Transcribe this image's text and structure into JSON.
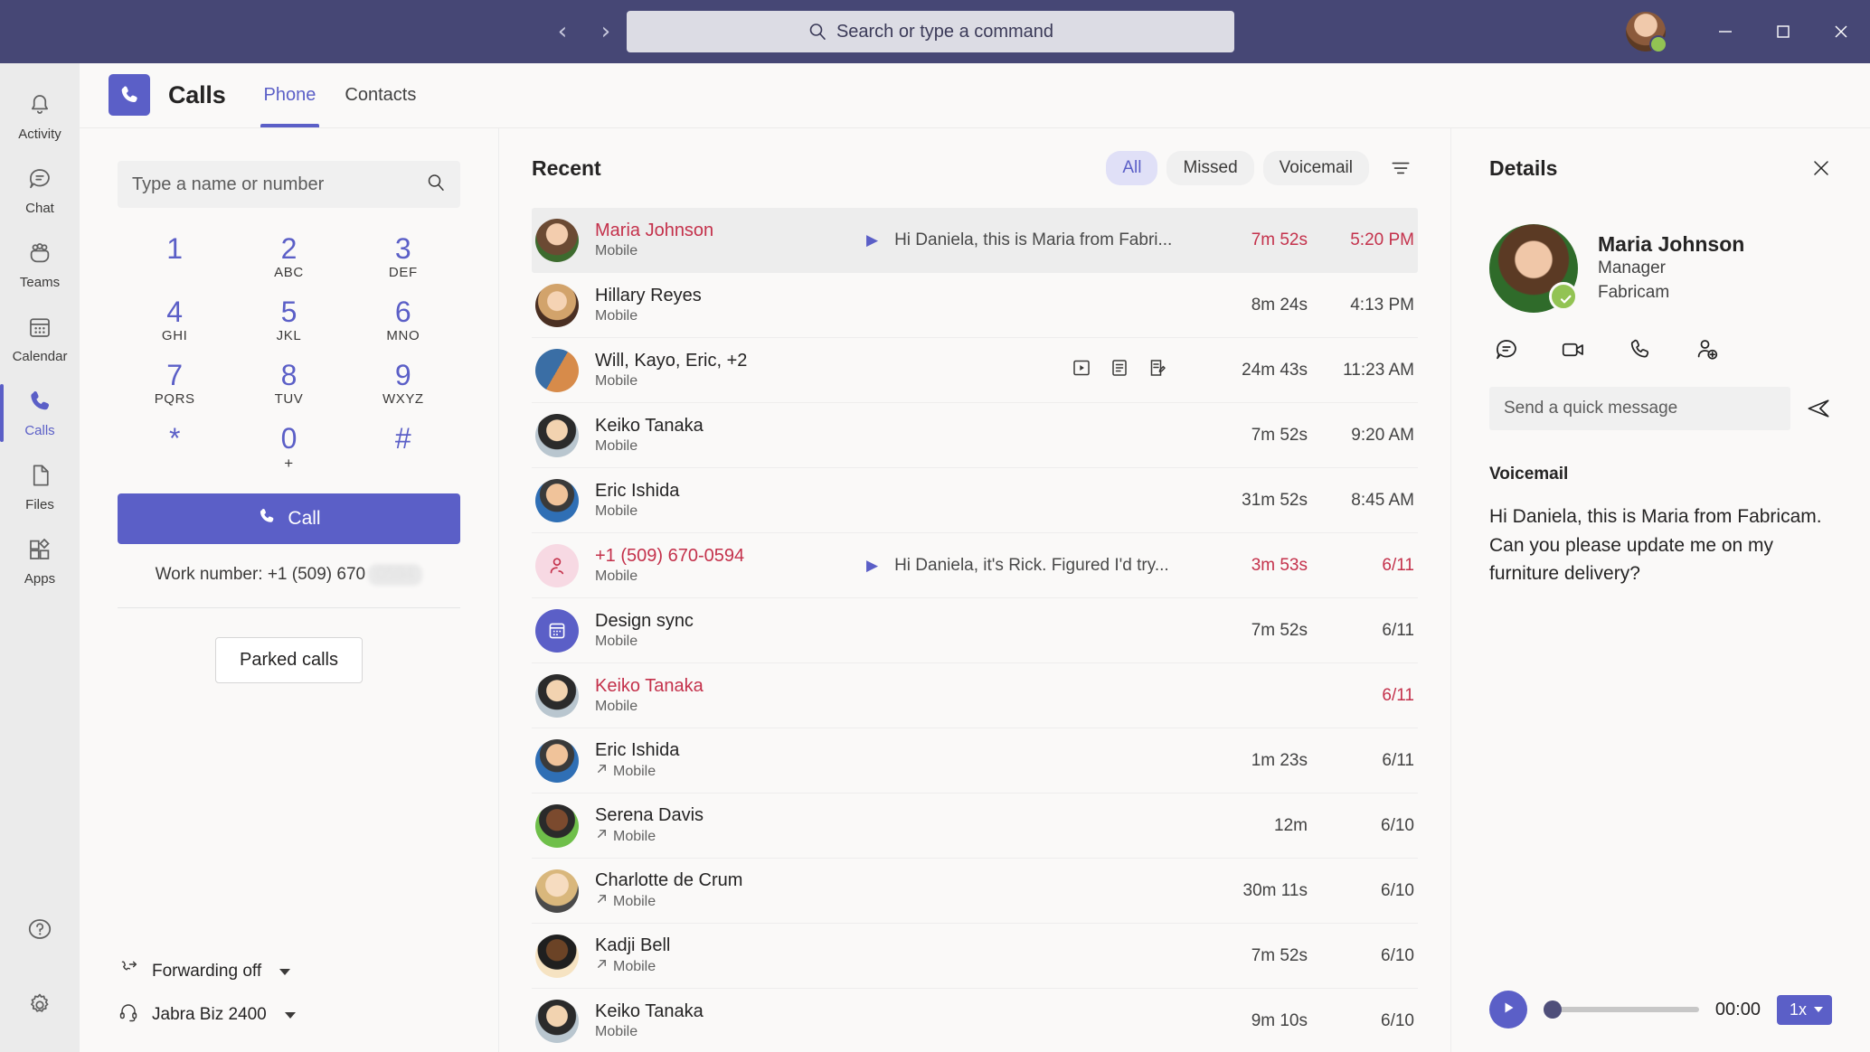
{
  "titlebar": {
    "back_label": "‹",
    "forward_label": "›",
    "search_placeholder": "Search or type a command",
    "minimize_label": "–",
    "maximize_label": "□",
    "close_label": "✕"
  },
  "rail": {
    "items": [
      {
        "label": "Activity",
        "icon": "bell-icon"
      },
      {
        "label": "Chat",
        "icon": "chat-icon"
      },
      {
        "label": "Teams",
        "icon": "teams-icon"
      },
      {
        "label": "Calendar",
        "icon": "calendar-icon"
      },
      {
        "label": "Calls",
        "icon": "phone-icon"
      },
      {
        "label": "Files",
        "icon": "file-icon"
      },
      {
        "label": "Apps",
        "icon": "apps-icon"
      }
    ],
    "help_label": "Help",
    "settings_label": "Settings"
  },
  "header": {
    "title": "Calls",
    "tabs": [
      {
        "label": "Phone",
        "active": true
      },
      {
        "label": "Contacts",
        "active": false
      }
    ]
  },
  "dialpad": {
    "search_placeholder": "Type a name or number",
    "keys": [
      {
        "digit": "1",
        "letters": ""
      },
      {
        "digit": "2",
        "letters": "ABC"
      },
      {
        "digit": "3",
        "letters": "DEF"
      },
      {
        "digit": "4",
        "letters": "GHI"
      },
      {
        "digit": "5",
        "letters": "JKL"
      },
      {
        "digit": "6",
        "letters": "MNO"
      },
      {
        "digit": "7",
        "letters": "PQRS"
      },
      {
        "digit": "8",
        "letters": "TUV"
      },
      {
        "digit": "9",
        "letters": "WXYZ"
      },
      {
        "digit": "*",
        "letters": ""
      },
      {
        "digit": "0",
        "letters": "+"
      },
      {
        "digit": "#",
        "letters": ""
      }
    ],
    "call_label": "Call",
    "work_number_label": "Work number: +1 (509) 670",
    "work_number_redacted": "0594",
    "parked_calls_label": "Parked calls",
    "forwarding_label": "Forwarding off",
    "device_label": "Jabra Biz 2400"
  },
  "recent": {
    "title": "Recent",
    "filters": [
      {
        "label": "All",
        "active": true
      },
      {
        "label": "Missed",
        "active": false
      },
      {
        "label": "Voicemail",
        "active": false
      }
    ],
    "filter_icon": "filter-icon",
    "rows": [
      {
        "name": "Maria Johnson",
        "sub": "Mobile",
        "missed": true,
        "selected": true,
        "voicemail_preview": "Hi Daniela, this is Maria from Fabri...",
        "has_play": true,
        "duration": "7m 52s",
        "time": "5:20 PM",
        "avatar": "a1",
        "outgoing": false,
        "icons": []
      },
      {
        "name": "Hillary Reyes",
        "sub": "Mobile",
        "missed": false,
        "selected": false,
        "voicemail_preview": "",
        "has_play": false,
        "duration": "8m 24s",
        "time": "4:13 PM",
        "avatar": "a2",
        "outgoing": false,
        "icons": []
      },
      {
        "name": "Will, Kayo, Eric, +2",
        "sub": "Mobile",
        "missed": false,
        "selected": false,
        "voicemail_preview": "",
        "has_play": false,
        "duration": "24m 43s",
        "time": "11:23 AM",
        "avatar": "a3",
        "outgoing": false,
        "icons": [
          "recording-icon",
          "transcript-icon",
          "notes-icon"
        ]
      },
      {
        "name": "Keiko Tanaka",
        "sub": "Mobile",
        "missed": false,
        "selected": false,
        "voicemail_preview": "",
        "has_play": false,
        "duration": "7m 52s",
        "time": "9:20 AM",
        "avatar": "a4",
        "outgoing": false,
        "icons": []
      },
      {
        "name": "Eric Ishida",
        "sub": "Mobile",
        "missed": false,
        "selected": false,
        "voicemail_preview": "",
        "has_play": false,
        "duration": "31m 52s",
        "time": "8:45 AM",
        "avatar": "a5",
        "outgoing": false,
        "icons": []
      },
      {
        "name": "+1 (509) 670-0594",
        "sub": "Mobile",
        "missed": true,
        "selected": false,
        "voicemail_preview": "Hi Daniela, it's Rick. Figured I'd try...",
        "has_play": true,
        "duration": "3m 53s",
        "time": "6/11",
        "avatar": "a6",
        "outgoing": false,
        "icons": []
      },
      {
        "name": "Design sync",
        "sub": "Mobile",
        "missed": false,
        "selected": false,
        "voicemail_preview": "",
        "has_play": false,
        "duration": "7m 52s",
        "time": "6/11",
        "avatar": "a7",
        "outgoing": false,
        "icons": []
      },
      {
        "name": "Keiko Tanaka",
        "sub": "Mobile",
        "missed": true,
        "selected": false,
        "voicemail_preview": "",
        "has_play": false,
        "duration": "",
        "time": "6/11",
        "avatar": "a4",
        "outgoing": false,
        "icons": []
      },
      {
        "name": "Eric Ishida",
        "sub": "Mobile",
        "missed": false,
        "selected": false,
        "voicemail_preview": "",
        "has_play": false,
        "duration": "1m 23s",
        "time": "6/11",
        "avatar": "a5",
        "outgoing": true,
        "icons": []
      },
      {
        "name": "Serena Davis",
        "sub": "Mobile",
        "missed": false,
        "selected": false,
        "voicemail_preview": "",
        "has_play": false,
        "duration": "12m",
        "time": "6/10",
        "avatar": "a8",
        "outgoing": true,
        "icons": []
      },
      {
        "name": "Charlotte de Crum",
        "sub": "Mobile",
        "missed": false,
        "selected": false,
        "voicemail_preview": "",
        "has_play": false,
        "duration": "30m 11s",
        "time": "6/10",
        "avatar": "a9",
        "outgoing": true,
        "icons": []
      },
      {
        "name": "Kadji Bell",
        "sub": "Mobile",
        "missed": false,
        "selected": false,
        "voicemail_preview": "",
        "has_play": false,
        "duration": "7m 52s",
        "time": "6/10",
        "avatar": "a10",
        "outgoing": true,
        "icons": []
      },
      {
        "name": "Keiko Tanaka",
        "sub": "Mobile",
        "missed": false,
        "selected": false,
        "voicemail_preview": "",
        "has_play": false,
        "duration": "9m 10s",
        "time": "6/10",
        "avatar": "a4",
        "outgoing": false,
        "icons": []
      }
    ]
  },
  "details": {
    "title": "Details",
    "close_label": "✕",
    "person": {
      "name": "Maria Johnson",
      "role": "Manager",
      "org": "Fabricam",
      "presence": "available"
    },
    "actions": [
      {
        "icon": "chat-bubble-icon",
        "label": "Chat"
      },
      {
        "icon": "video-camera-icon",
        "label": "Video call"
      },
      {
        "icon": "phone-call-icon",
        "label": "Audio call"
      },
      {
        "icon": "add-person-icon",
        "label": "Add contact"
      }
    ],
    "quick_message_placeholder": "Send a quick message",
    "send_icon": "send-icon",
    "voicemail_label": "Voicemail",
    "voicemail_text": "Hi Daniela, this is Maria from Fabricam. Can you please update me on my furniture delivery?",
    "player": {
      "play_icon": "play-icon",
      "current_time": "00:00",
      "speed": "1x",
      "progress_percent": 0
    }
  },
  "colors": {
    "brand": "#5b5fc7",
    "titlebar": "#464775",
    "missed": "#c4314b",
    "presence_available": "#92c353"
  }
}
